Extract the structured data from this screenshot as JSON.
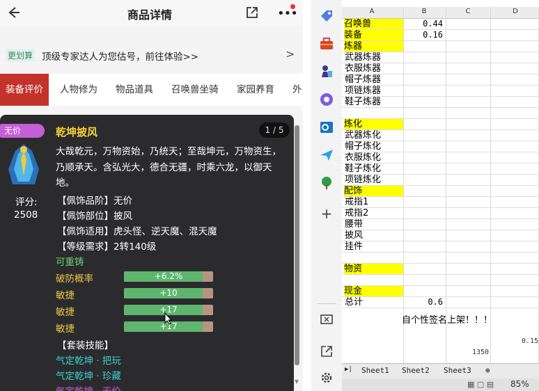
{
  "header": {
    "title": "商品详情"
  },
  "promo": {
    "tag": "更划算",
    "text": "顶级专家达人为您估号，前往体验>>"
  },
  "tabs": [
    "装备评价",
    "人物修为",
    "物品道具",
    "召唤兽坐骑",
    "家园养育",
    "外"
  ],
  "card": {
    "badge": "无价",
    "name": "乾坤披风",
    "pager": "1 / 5",
    "description": "大哉乾元，万物资始，乃统天；至哉坤元，万物资生，乃顺承天。含弘光大，德合无疆，时乘六龙，以御天地。",
    "score_label": "评分:",
    "score_value": "2508",
    "attrs": [
      "【佩饰品阶】无价",
      "【佩饰部位】披风",
      "【佩饰适用】虎头怪、逆天魔、混天魔",
      "【等级需求】2转140级"
    ],
    "reforge": "可重铸",
    "stats": [
      {
        "name": "破防概率",
        "value": "+6.2%",
        "fill": 0.88
      },
      {
        "name": "敏捷",
        "value": "+10",
        "fill": 0.88
      },
      {
        "name": "敏捷",
        "value": "+17",
        "fill": 0.88
      },
      {
        "name": "敏捷",
        "value": "+17",
        "fill": 0.88
      }
    ],
    "set_title": "【套装技能】",
    "skills": [
      {
        "text": "气定乾坤 · 把玩",
        "color": "#37d0c9"
      },
      {
        "text": "气定乾坤 · 珍藏",
        "color": "#37d0c9"
      },
      {
        "text": "气定乾坤 · 无价",
        "color": "#c85be0"
      }
    ]
  },
  "excel": {
    "columns": [
      "A",
      "B",
      "C",
      "D"
    ],
    "rows": [
      {
        "a": "召唤兽",
        "b": "0.44",
        "yellow": true
      },
      {
        "a": "装备",
        "b": "0.16",
        "yellow": true
      },
      {
        "a": "炼器",
        "b": "",
        "yellow": true
      },
      {
        "a": "武器炼器",
        "b": "",
        "yellow": false
      },
      {
        "a": "衣服炼器",
        "b": "",
        "yellow": false
      },
      {
        "a": "帽子炼器",
        "b": "",
        "yellow": false
      },
      {
        "a": "项链炼器",
        "b": "",
        "yellow": false
      },
      {
        "a": "鞋子炼器",
        "b": "",
        "yellow": false
      },
      {
        "a": "",
        "b": "",
        "yellow": false
      },
      {
        "a": "炼化",
        "b": "",
        "yellow": true
      },
      {
        "a": "武器炼化",
        "b": "",
        "yellow": false
      },
      {
        "a": "帽子炼化",
        "b": "",
        "yellow": false
      },
      {
        "a": "衣服炼化",
        "b": "",
        "yellow": false
      },
      {
        "a": "鞋子炼化",
        "b": "",
        "yellow": false
      },
      {
        "a": "项链炼化",
        "b": "",
        "yellow": false
      },
      {
        "a": "配饰",
        "b": "",
        "yellow": true
      },
      {
        "a": "戒指1",
        "b": "",
        "yellow": false
      },
      {
        "a": "戒指2",
        "b": "",
        "yellow": false
      },
      {
        "a": "腰带",
        "b": "",
        "yellow": false
      },
      {
        "a": "披风",
        "b": "",
        "yellow": false
      },
      {
        "a": "挂件",
        "b": "",
        "yellow": false
      },
      {
        "a": "",
        "b": "",
        "yellow": false
      },
      {
        "a": "物资",
        "b": "",
        "yellow": true
      },
      {
        "a": "",
        "b": "",
        "yellow": false
      },
      {
        "a": "现金",
        "b": "",
        "yellow": true
      },
      {
        "a": "总计",
        "b": "0.6",
        "yellow": false
      }
    ],
    "banner": "自个性签名上架！！！",
    "num_right": "0.15",
    "num_bottom": "1350",
    "sheets": [
      "Sheet1",
      "Sheet2",
      "Sheet3"
    ],
    "zoom": "85%"
  },
  "colors": {
    "tab_active": "#c3322b",
    "card_bg": "#2b2b2d",
    "excel_yellow": "#ffff00",
    "stat_fill": "#5fb56e"
  }
}
